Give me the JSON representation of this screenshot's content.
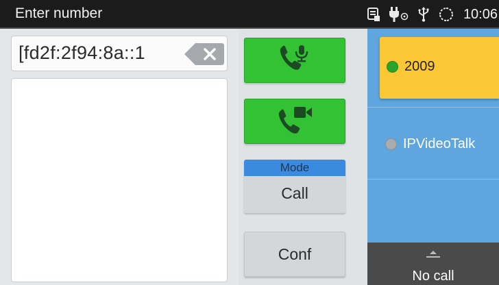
{
  "status_bar": {
    "title": "Enter number",
    "time": "10:06",
    "icons": [
      "contacts-card-icon",
      "power-plug-icon",
      "usb-icon",
      "sync-icon"
    ]
  },
  "dialer": {
    "number_value": "[fd2f:2f94:8a::1",
    "backspace_icon": "backspace-icon"
  },
  "buttons": {
    "voice_call_icon": "phone-mic-icon",
    "video_call_icon": "phone-video-icon",
    "mode_header": "Mode",
    "mode_value": "Call",
    "conf_label": "Conf"
  },
  "accounts": [
    {
      "label": "2009",
      "status_color": "#2aa52a",
      "selected": true
    },
    {
      "label": "IPVideoTalk",
      "status_color": "#a9adb0",
      "selected": false
    }
  ],
  "call_status": {
    "label": "No call"
  },
  "colors": {
    "green_button": "#33c233",
    "mode_header": "#3a8be0",
    "accounts_panel": "#5ea6dd",
    "selected_account": "#fcc735",
    "status_bar": "#1b1b1b"
  }
}
